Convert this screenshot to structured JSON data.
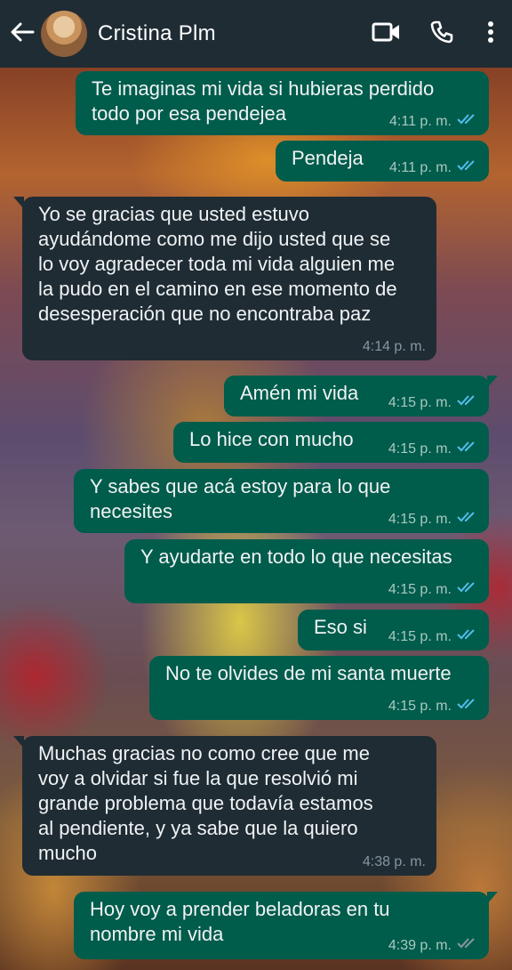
{
  "header": {
    "contact_name": "Cristina Plm",
    "icons": [
      "back-arrow-icon",
      "video-call-icon",
      "voice-call-icon",
      "more-options-icon"
    ]
  },
  "colors": {
    "header_bg": "#1f2c34",
    "outgoing_bubble": "#005c4b",
    "incoming_bubble": "#1f2c34",
    "read_tick": "#53bdeb"
  },
  "messages": [
    {
      "dir": "out",
      "text": "Te imaginas mi vida si hubieras perdido\ntodo por esa pendejea",
      "time": "4:11 p. m.",
      "read": true
    },
    {
      "dir": "out",
      "text": "Pendeja",
      "time": "4:11 p. m.",
      "read": true
    },
    {
      "dir": "in",
      "text": "Yo se gracias que usted estuvo\nayudándome como me dijo usted que se\nlo voy agradecer toda mi vida alguien me\nla pudo en el camino en ese momento de\ndesesperación que no encontraba paz",
      "time": "4:14 p. m."
    },
    {
      "dir": "out",
      "text": "Amén mi vida",
      "time": "4:15 p. m.",
      "read": true
    },
    {
      "dir": "out",
      "text": "Lo hice con mucho",
      "time": "4:15 p. m.",
      "read": true
    },
    {
      "dir": "out",
      "text": "Y sabes que acá estoy para lo que\nnecesites",
      "time": "4:15 p. m.",
      "read": true
    },
    {
      "dir": "out",
      "text": "Y ayudarte en todo lo que necesitas",
      "time": "4:15 p. m.",
      "read": true
    },
    {
      "dir": "out",
      "text": "Eso si",
      "time": "4:15 p. m.",
      "read": true
    },
    {
      "dir": "out",
      "text": "No te olvides de mi santa muerte",
      "time": "4:15 p. m.",
      "read": true
    },
    {
      "dir": "in",
      "text": "Muchas gracias no como cree que me\nvoy a olvidar si fue la que resolvió mi\ngrande problema que todavía estamos\nal pendiente, y ya sabe que la quiero\nmucho",
      "time": "4:38 p. m."
    },
    {
      "dir": "out",
      "text": "Hoy voy a prender beladoras en tu\nnombre mi vida",
      "time": "4:39 p. m.",
      "read": true
    }
  ]
}
